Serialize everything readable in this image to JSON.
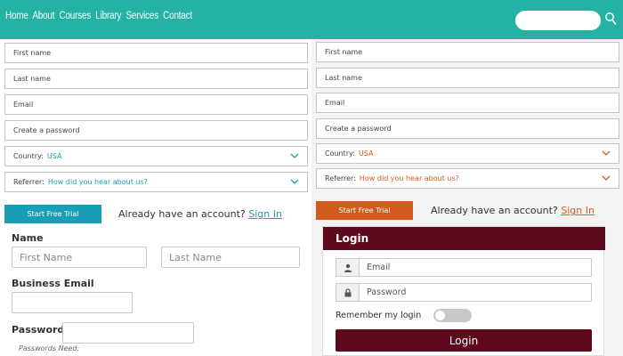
{
  "nav": {
    "items": [
      "Home",
      "About",
      "Courses",
      "Library",
      "Services",
      "Contact"
    ],
    "search_placeholder": ""
  },
  "form_left": {
    "first_name": "First name",
    "last_name": "Last name",
    "email": "Email",
    "password": "Create a password",
    "country_label": "Country:",
    "country_value": "USA",
    "referrer_label": "Referrer:",
    "referrer_value": "How did you hear about us?",
    "trial_button": "Start Free Trial",
    "already_text": "Already have an account?",
    "sign_in": "Sign In",
    "accent": "#1a9eb5"
  },
  "form_right": {
    "first_name": "First name",
    "last_name": "Last name",
    "email": "Email",
    "password": "Create a password",
    "country_label": "Country:",
    "country_value": "USA",
    "referrer_label": "Referrer:",
    "referrer_value": "How did you hear about us?",
    "trial_button": "Start Free Trial",
    "already_text": "Already have an account?",
    "sign_in": "Sign In",
    "accent": "#d35a1a"
  },
  "signup": {
    "name_label": "Name",
    "first_placeholder": "First Name",
    "last_placeholder": "Last Name",
    "email_label": "Business Email",
    "password_label": "Password",
    "password_hint": "Passwords Need:"
  },
  "login": {
    "title": "Login",
    "email_placeholder": "Email",
    "password_placeholder": "Password",
    "remember_label": "Remember my login",
    "remember_on": false,
    "button_label": "Login",
    "brand_color": "#5e0a1d"
  }
}
